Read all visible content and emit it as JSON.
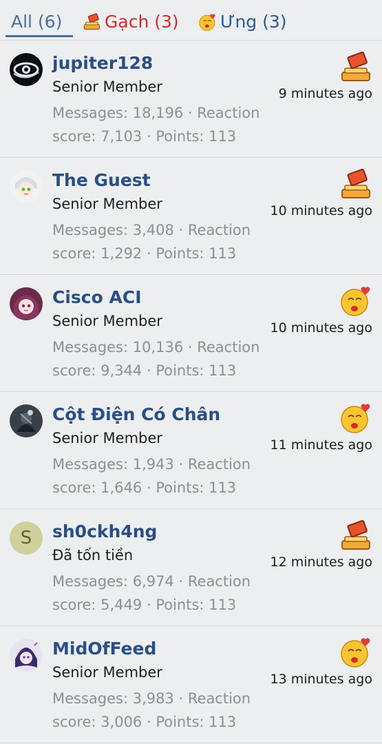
{
  "tabs": [
    {
      "label": "All (6)",
      "icon": null
    },
    {
      "label": "Gạch (3)",
      "icon": "brick-reaction-icon",
      "color": "#d12b2b"
    },
    {
      "label": "Ưng (3)",
      "icon": "kiss-reaction-icon",
      "color": "#2c5b95"
    }
  ],
  "accent": "#4a6f9c",
  "users": [
    {
      "name": "jupiter128",
      "title": "Senior Member",
      "stats": "Messages: 18,196 · Reaction score: 7,103 · Points: 113",
      "time": "9 minutes ago",
      "reaction": "brick-reaction-icon",
      "avatar": "eye-logo-avatar"
    },
    {
      "name": "The Guest",
      "title": "Senior Member",
      "stats": "Messages: 3,408 · Reaction score: 1,292 · Points: 113",
      "time": "10 minutes ago",
      "reaction": "brick-reaction-icon",
      "avatar": "anime-white-hair-avatar"
    },
    {
      "name": "Cisco ACI",
      "title": "Senior Member",
      "stats": "Messages: 10,136 · Reaction score: 9,344 · Points: 113",
      "time": "10 minutes ago",
      "reaction": "kiss-reaction-icon",
      "avatar": "anime-purple-hair-avatar"
    },
    {
      "name": "Cột Điện Có Chân",
      "title": "Senior Member",
      "stats": "Messages: 1,943 · Reaction score: 1,646 · Points: 113",
      "time": "11 minutes ago",
      "reaction": "kiss-reaction-icon",
      "avatar": "dark-armor-avatar"
    },
    {
      "name": "sh0ckh4ng",
      "title": "Đã tốn tiền",
      "stats": "Messages: 6,974 · Reaction score: 5,449 · Points: 113",
      "time": "12 minutes ago",
      "reaction": "brick-reaction-icon",
      "avatar_letter": "S"
    },
    {
      "name": "MidOfFeed",
      "title": "Senior Member",
      "stats": "Messages: 3,983 · Reaction score: 3,006 · Points: 113",
      "time": "13 minutes ago",
      "reaction": "kiss-reaction-icon",
      "avatar": "anime-dark-purple-avatar"
    }
  ]
}
